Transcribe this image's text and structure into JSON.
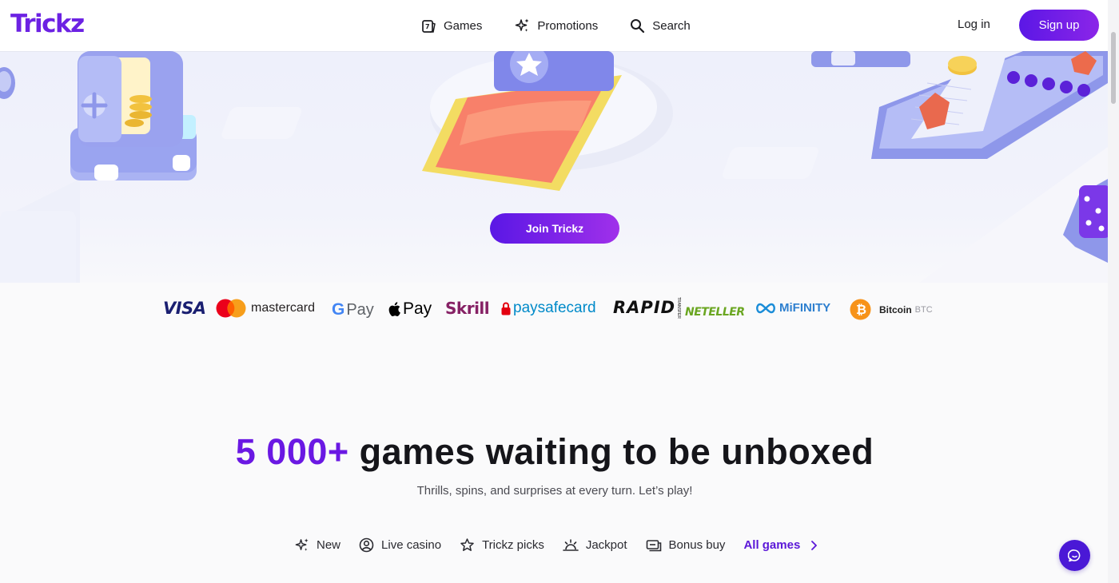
{
  "header": {
    "logo": "Trickz",
    "nav": [
      {
        "label": "Games",
        "icon": "games-icon"
      },
      {
        "label": "Promotions",
        "icon": "sparkle-icon"
      },
      {
        "label": "Search",
        "icon": "search-icon"
      }
    ],
    "login_label": "Log in",
    "signup_label": "Sign up"
  },
  "hero": {
    "join_label": "Join Trickz"
  },
  "payments": {
    "visa": "VISA",
    "mastercard": "mastercard",
    "gpay": "Pay",
    "applepay": "Pay",
    "skrill": "Skrill",
    "paysafecard": "paysafecard",
    "rapid": "RAPID",
    "rapid_sub": "TRANSFER",
    "neteller": "NETELLER",
    "mifinity": "MiFINITY",
    "bitcoin": "Bitcoin",
    "bitcoin_ticker": "BTC"
  },
  "games_section": {
    "headline_accent": "5 000+",
    "headline_rest": " games waiting to be unboxed",
    "subtitle": "Thrills, spins, and surprises at every turn. Let’s play!",
    "categories": [
      {
        "label": "New",
        "icon": "sparkle-icon"
      },
      {
        "label": "Live casino",
        "icon": "user-circle-icon"
      },
      {
        "label": "Trickz picks",
        "icon": "star-icon"
      },
      {
        "label": "Jackpot",
        "icon": "sunrise-icon"
      },
      {
        "label": "Bonus buy",
        "icon": "cart-icon"
      }
    ],
    "all_games_label": "All games"
  },
  "colors": {
    "brand": "#6a18e3",
    "button_gradient_start": "#5b17e6",
    "button_gradient_end": "#8b25e8",
    "chat": "#4a18d6"
  }
}
